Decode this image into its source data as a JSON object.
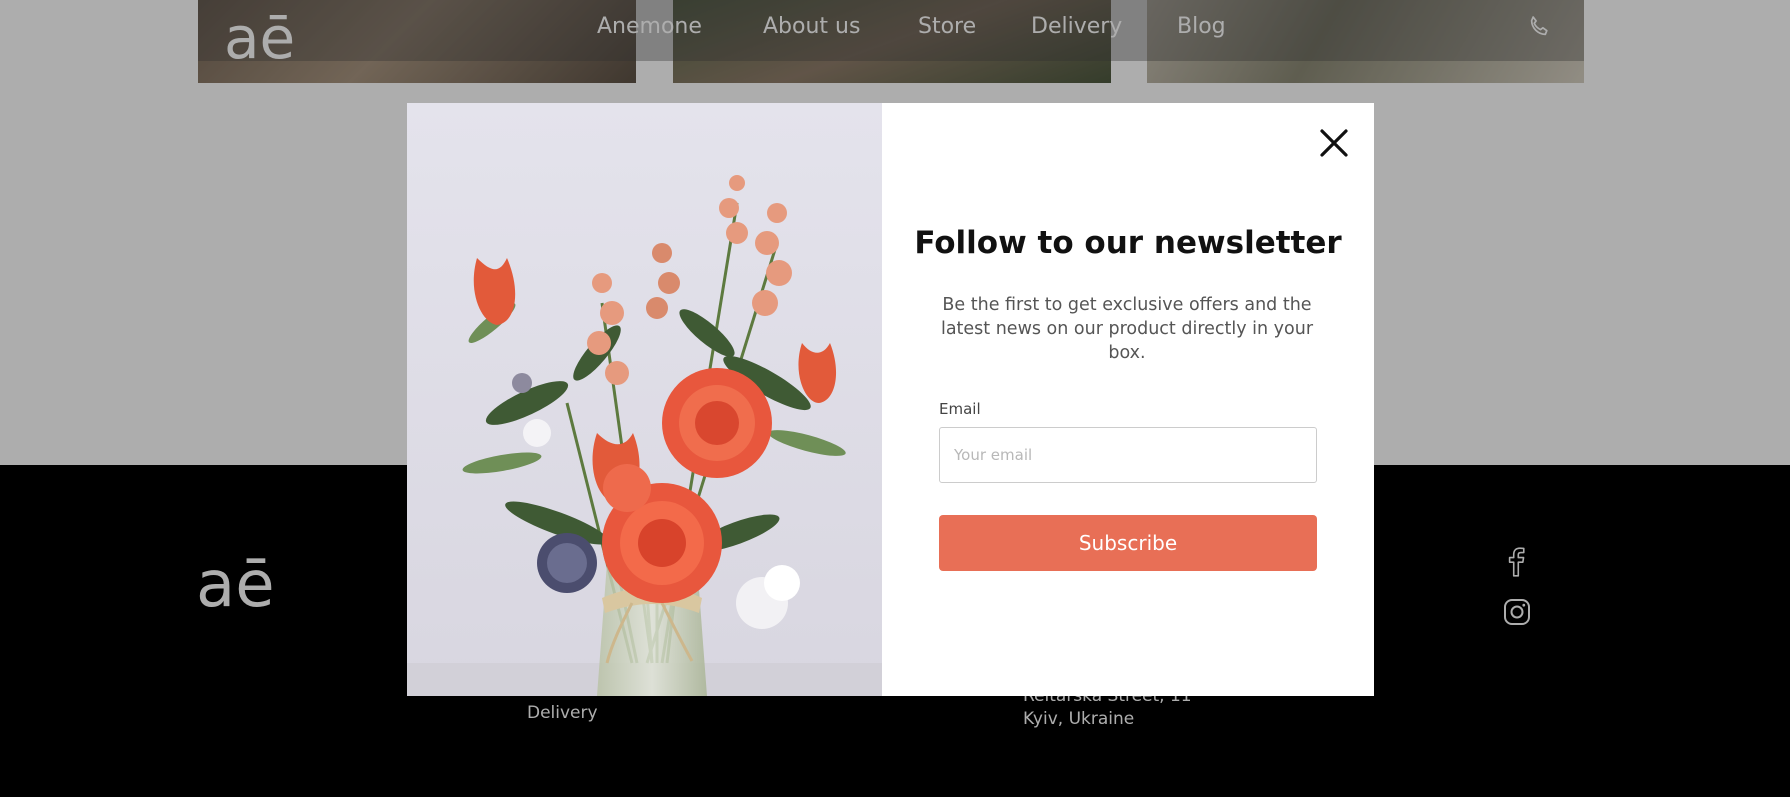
{
  "header": {
    "logo_text": "aē",
    "nav": [
      "Anemone",
      "About us",
      "Store",
      "Delivery",
      "Blog"
    ],
    "phone_icon": "phone-icon"
  },
  "footer": {
    "logo_text": "aē",
    "link_delivery": "Delivery",
    "address_line1": "Reitarska Street, 11",
    "address_line2": "Kyiv, Ukraine",
    "social_icons": [
      "facebook-icon",
      "instagram-icon"
    ]
  },
  "modal": {
    "title": "Follow to our newsletter",
    "description": "Be the first to get exclusive offers and the latest news on our product directly in your box.",
    "email_label": "Email",
    "email_placeholder": "Your email",
    "email_value": "",
    "subscribe_label": "Subscribe",
    "close_icon": "close-icon"
  },
  "colors": {
    "accent": "#e86f56",
    "footer_bg": "#000000",
    "overlay": "rgba(0,0,0,0.32)"
  }
}
